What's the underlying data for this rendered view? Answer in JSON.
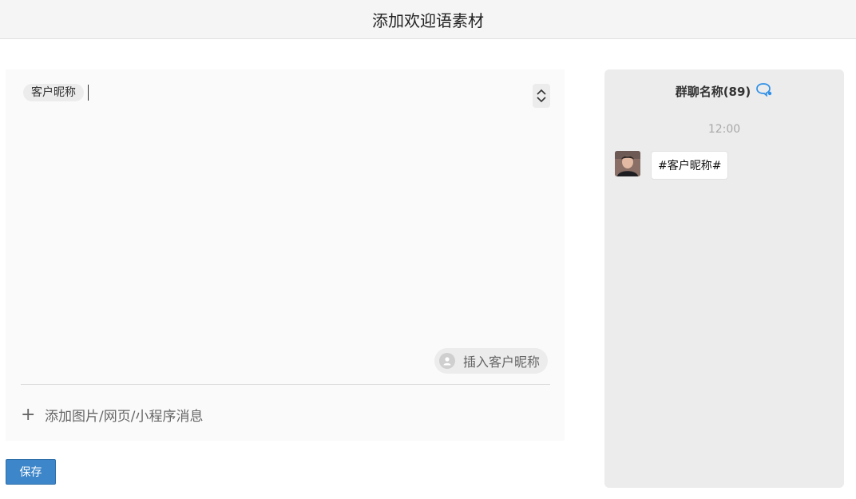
{
  "header": {
    "title": "添加欢迎语素材"
  },
  "editor": {
    "nickname_tag": "客户昵称",
    "insert_nickname_label": "插入客户昵称",
    "add_attachment_label": "添加图片/网页/小程序消息",
    "add_icon": "plus-icon",
    "stepper_icons": [
      "chevron-up-icon",
      "chevron-down-icon"
    ]
  },
  "actions": {
    "save_label": "保存"
  },
  "preview": {
    "group_name": "群聊名称(89)",
    "group_icon": "chat-bubble-icon",
    "time": "12:00",
    "message_text": "#客户昵称#"
  },
  "colors": {
    "primary_button": "#3d86c9",
    "chat_icon": "#2e8fe8",
    "preview_background": "#ececec",
    "editor_background": "#fafafa"
  }
}
